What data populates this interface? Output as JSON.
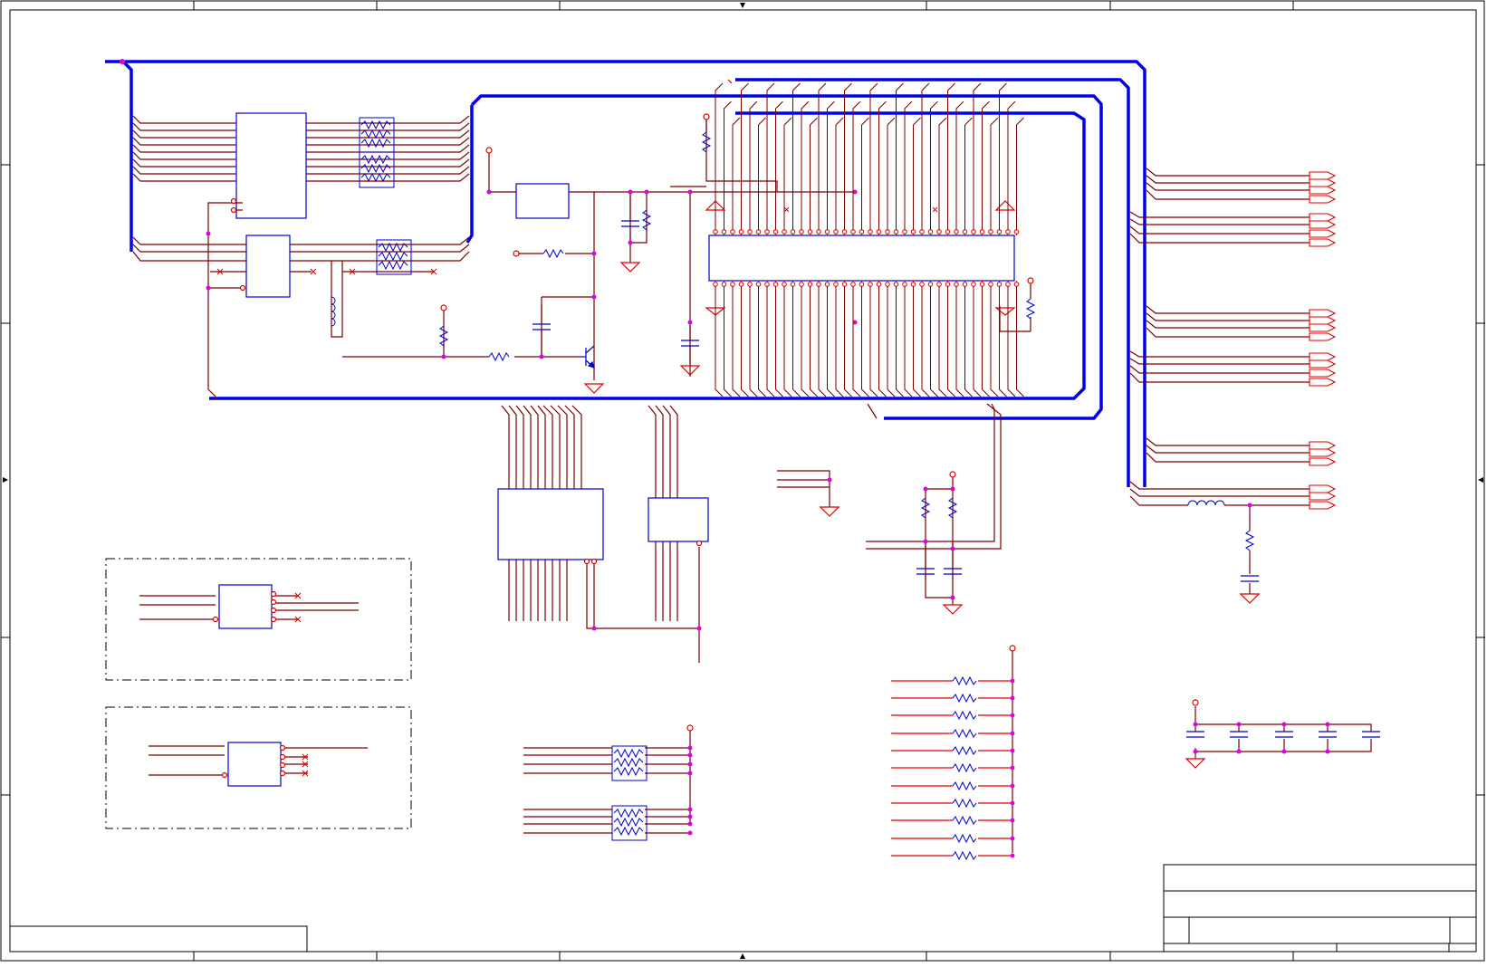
{
  "sheet": {
    "title": "",
    "colors": {
      "wire": "#e00000",
      "bus": "#0000e6",
      "component": "#0000c8",
      "junction": "#e000e0",
      "frame": "#000000",
      "net_wire": "#7a0000"
    }
  },
  "components": {
    "connector_chip_labels": [],
    "component_designators": []
  },
  "title_block": {
    "title": "",
    "size": "",
    "document_number": "",
    "revision": "",
    "sheet": "",
    "date": ""
  },
  "notes": {
    "lower_left_box": ""
  },
  "icons": {
    "ground_symbol": "ground-icon",
    "power_symbol": "power-rail-icon",
    "resistor": "resistor-icon",
    "capacitor": "capacitor-icon",
    "inductor": "inductor-icon",
    "transistor": "npn-transistor-icon",
    "resistor_network": "resistor-network-icon",
    "connector": "edge-connector-icon"
  }
}
